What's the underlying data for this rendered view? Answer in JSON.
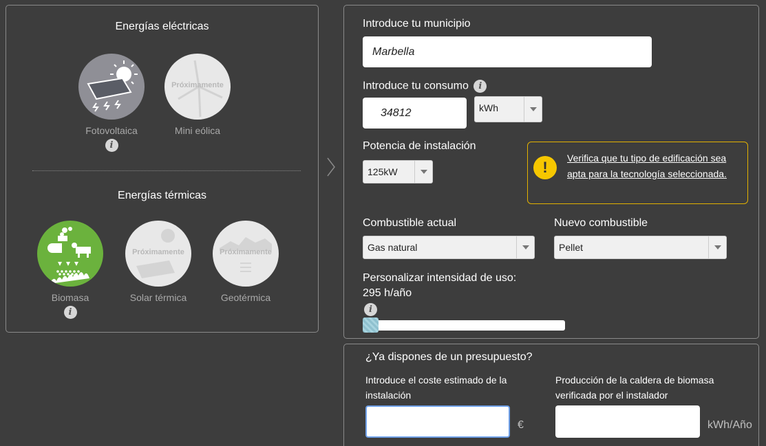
{
  "left": {
    "electric_title": "Energías eléctricas",
    "thermal_title": "Energías térmicas",
    "soon_text": "Próximamente",
    "electric": [
      {
        "label": "Fotovoltaica",
        "has_info": true
      },
      {
        "label": "Mini eólica",
        "has_info": false
      }
    ],
    "thermal": [
      {
        "label": "Biomasa",
        "has_info": true
      },
      {
        "label": "Solar térmica",
        "has_info": false
      },
      {
        "label": "Geotérmica",
        "has_info": false
      }
    ]
  },
  "form": {
    "municipality_label": "Introduce tu municipio",
    "municipality_value": "Marbella",
    "consumption_label": "Introduce tu consumo",
    "consumption_value": "34812",
    "consumption_unit": "kWh",
    "power_label": "Potencia de instalación",
    "power_value": "125kW",
    "warning_text": "Verifica que tu tipo de edificación sea apta para la tecnología seleccionada.",
    "current_fuel_label": "Combustible actual",
    "current_fuel_value": "Gas natural",
    "new_fuel_label": "Nuevo combustible",
    "new_fuel_value": "Pellet",
    "intensity_label": "Personalizar intensidad de uso:",
    "intensity_value": "295 h/año",
    "intensity_slider_fraction": 0.0
  },
  "budget": {
    "question": "¿Ya dispones de un presupuesto?",
    "cost_label": "Introduce el coste estimado de la instalación",
    "cost_unit": "€",
    "production_label": "Producción de la caldera de biomasa verificada por el instalador",
    "production_unit": "kWh/Año"
  },
  "info_glyph": "i",
  "warning_glyph": "!",
  "colors": {
    "background": "#3d3d3d",
    "biomass_green": "#6bb23d",
    "warning_yellow": "#f6c700",
    "slider_handle": "#8fc1cf"
  }
}
